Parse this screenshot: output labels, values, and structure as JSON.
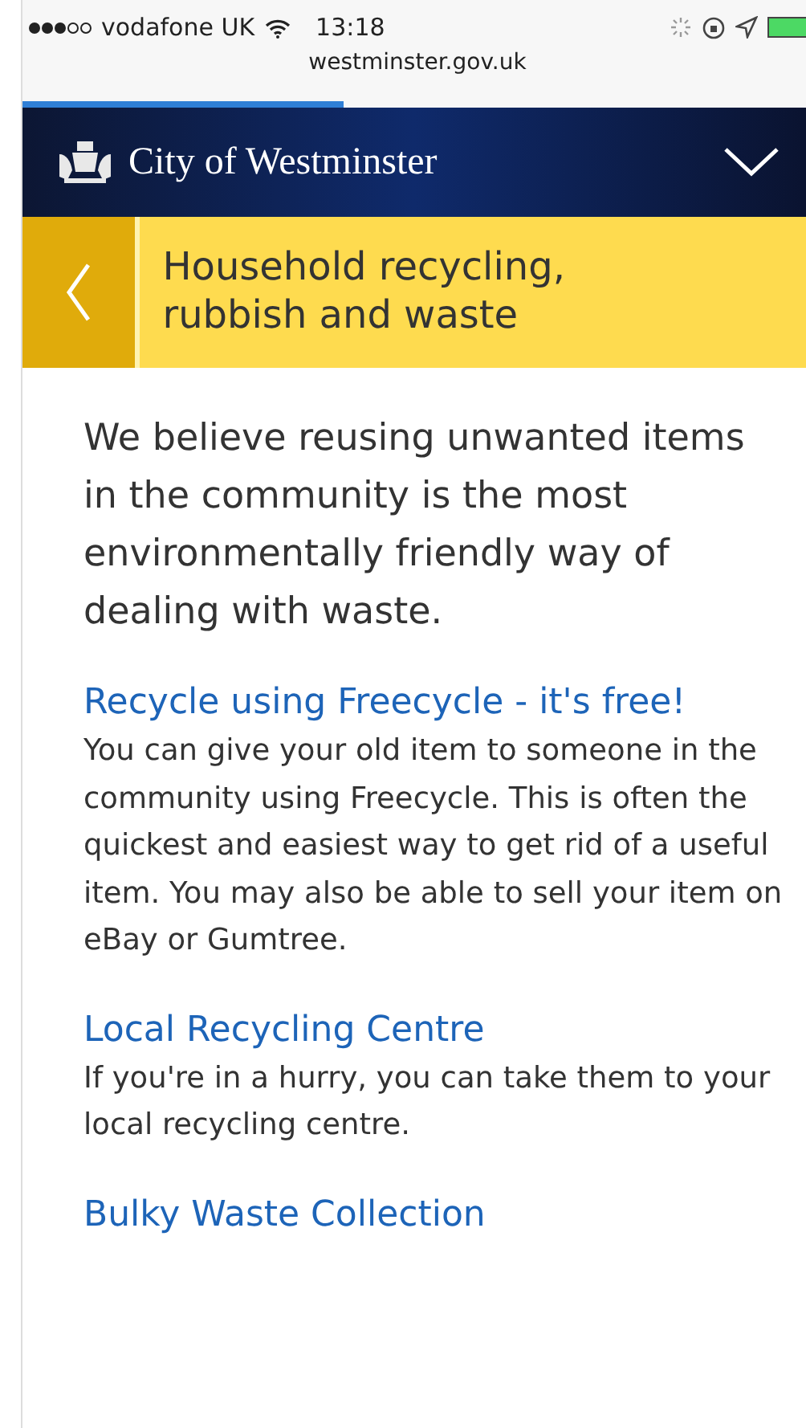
{
  "status_bar": {
    "carrier": "vodafone UK",
    "time": "13:18",
    "url": "westminster.gov.uk"
  },
  "loading": {
    "level": 0.41
  },
  "header": {
    "title": "City of Westminster"
  },
  "section": {
    "title": "Household recycling, rubbish and waste"
  },
  "intro": "We believe reusing unwanted items in the community is the most environmentally friendly way of dealing with waste.",
  "options": [
    {
      "link": "Recycle using Freecycle - it's free!",
      "text": "You can give your old item to someone in the community using Freecycle. This is often the quickest and easiest way to get rid of a useful item. You may also be able to sell your item on eBay or Gumtree."
    },
    {
      "link": "Local Recycling Centre",
      "text": "If you're in a hurry, you can take them to your local recycling centre."
    },
    {
      "link": "Bulky Waste Collection"
    }
  ]
}
